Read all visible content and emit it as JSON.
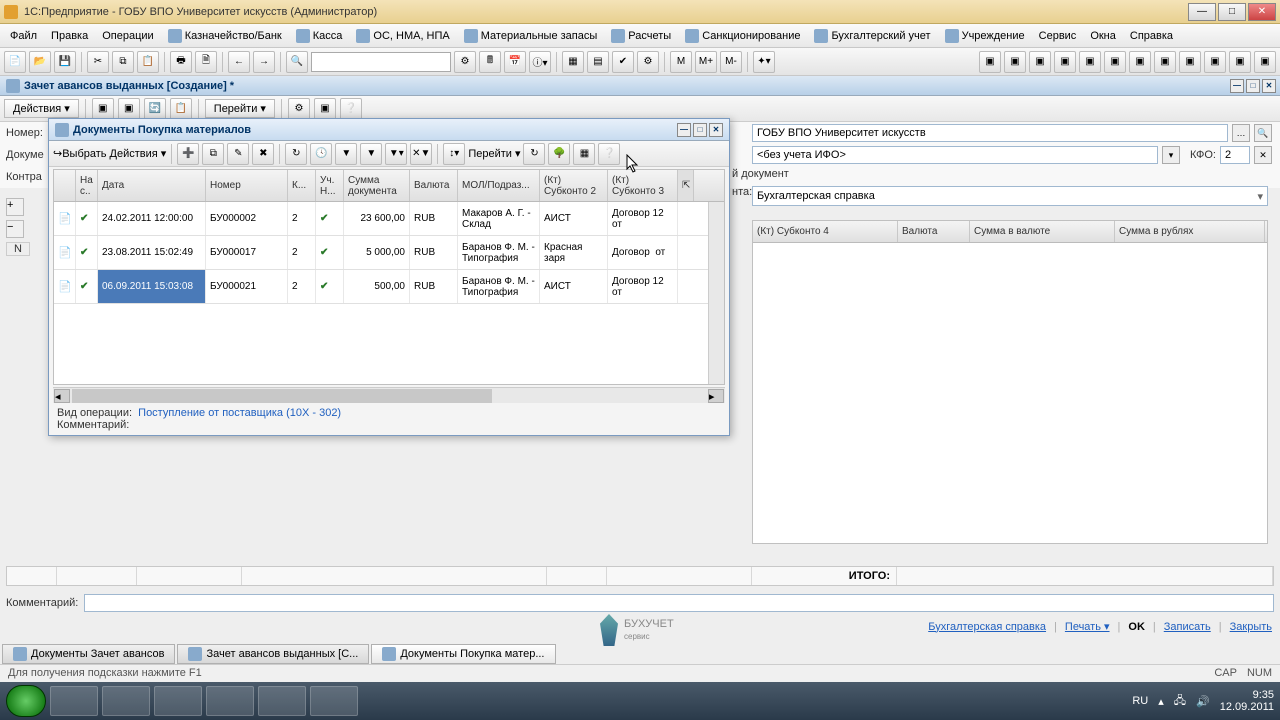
{
  "titlebar": {
    "title": "1С:Предприятие - ГОБУ ВПО Университет искусств  (Администратор)"
  },
  "menu": [
    "Файл",
    "Правка",
    "Операции",
    "Казначейство/Банк",
    "Касса",
    "ОС, НМА, НПА",
    "Материальные запасы",
    "Расчеты",
    "Санкционирование",
    "Бухгалтерский учет",
    "Учреждение",
    "Сервис",
    "Окна",
    "Справка"
  ],
  "toolbar2_text": {
    "m": "M",
    "mp": "M+",
    "mm": "M-"
  },
  "doctab": {
    "title": "Зачет авансов выданных [Создание] *"
  },
  "inner_tb": {
    "actions": "Действия ▾",
    "goto": "Перейти ▾"
  },
  "form": {
    "lbl_number": "Номер:",
    "lbl_doc": "Докуме",
    "lbl_contr": "Контра",
    "n": "N"
  },
  "right": {
    "org": "ГОБУ ВПО Университет искусств",
    "ifo": "<без учета ИФО>",
    "kfo_lbl": "КФО:",
    "kfo": "2",
    "partial": "й документ",
    "nta_lbl": "нта:",
    "spravka": "Бухгалтерская справка",
    "grid_heads": [
      "(Кт) Субконто 4",
      "Валюта",
      "Сумма в валюте",
      "Сумма в рублях"
    ]
  },
  "modal": {
    "title": "Документы Покупка материалов",
    "select": "Выбрать",
    "actions": "Действия ▾",
    "goto": "Перейти ▾",
    "heads": [
      "",
      "На с..",
      "Дата",
      "Номер",
      "К...",
      "Уч. Н...",
      "Сумма документа",
      "Валюта",
      "МОЛ/Подраз...",
      "(Кт) Субконто 2",
      "(Кт) Субконто 3"
    ],
    "rows": [
      {
        "date": "24.02.2011 12:00:00",
        "num": "БУ000002",
        "k": "2",
        "sum": "23 600,00",
        "cur": "RUB",
        "mol": "Макаров А. Г. - Склад",
        "s2": "АИСТ",
        "s3": "Договор 12 от"
      },
      {
        "date": "23.08.2011 15:02:49",
        "num": "БУ000017",
        "k": "2",
        "sum": "5 000,00",
        "cur": "RUB",
        "mol": "Баранов Ф. М. - Типография",
        "s2": "Красная заря",
        "s3": "Договор  от"
      },
      {
        "date": "06.09.2011 15:03:08",
        "num": "БУ000021",
        "k": "2",
        "sum": "500,00",
        "cur": "RUB",
        "mol": "Баранов Ф. М. - Типография",
        "s2": "АИСТ",
        "s3": "Договор 12 от"
      }
    ],
    "foot_op_lbl": "Вид операции:",
    "foot_op": "Поступление от поставщика (10Х - 302)",
    "foot_comm": "Комментарий:"
  },
  "totals": {
    "label": "ИТОГО:"
  },
  "comment_lbl": "Комментарий:",
  "foot_btns": {
    "spravka": "Бухгалтерская справка",
    "print": "Печать ▾",
    "ok": "OK",
    "save": "Записать",
    "close": "Закрыть"
  },
  "brand": "БУХУЧЕТ",
  "wintabs": [
    "Документы Зачет авансов",
    "Зачет авансов выданных [С...",
    "Документы Покупка матер..."
  ],
  "status": {
    "hint": "Для получения подсказки нажмите F1",
    "cap": "CAP",
    "num": "NUM"
  },
  "tray": {
    "lang": "RU",
    "time": "9:35",
    "date": "12.09.2011"
  }
}
